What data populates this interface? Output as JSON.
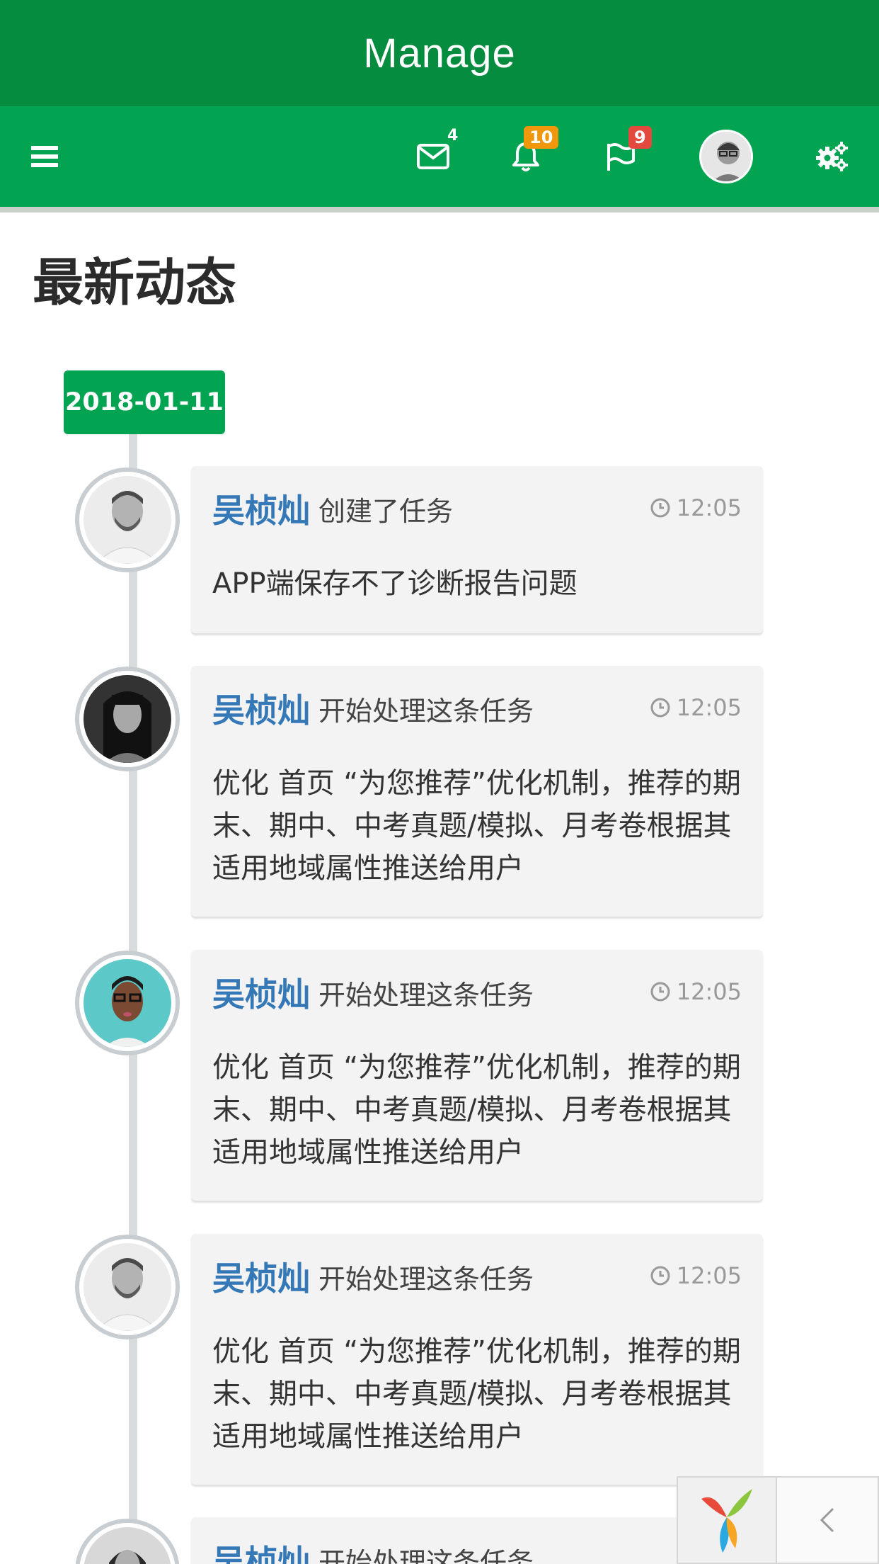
{
  "header": {
    "title": "Manage"
  },
  "toolbar": {
    "menu_icon": "hamburger-icon",
    "mail_badge": "4",
    "bell_badge": "10",
    "flag_badge": "9",
    "settings_icon": "gears-icon",
    "colors": {
      "title_bar": "#058c3f",
      "toolbar": "#02a451",
      "badge_orange": "#f0970b",
      "badge_red": "#e3493d"
    }
  },
  "page": {
    "title": "最新动态"
  },
  "timeline": {
    "date": "2018-01-11",
    "entries": [
      {
        "user": "吴桢灿",
        "action": "创建了任务",
        "time": "12:05",
        "body": "APP端保存不了诊断报告问题"
      },
      {
        "user": "吴桢灿",
        "action": "开始处理这条任务",
        "time": "12:05",
        "body": "优化 首页 “为您推荐”优化机制，推荐的期末、期中、中考真题/模拟、月考卷根据其适用地域属性推送给用户"
      },
      {
        "user": "吴桢灿",
        "action": "开始处理这条任务",
        "time": "12:05",
        "body": "优化 首页 “为您推荐”优化机制，推荐的期末、期中、中考真题/模拟、月考卷根据其适用地域属性推送给用户"
      },
      {
        "user": "吴桢灿",
        "action": "开始处理这条任务",
        "time": "12:05",
        "body": "优化 首页 “为您推荐”优化机制，推荐的期末、期中、中考真题/模拟、月考卷根据其适用地域属性推送给用户"
      },
      {
        "user": "吴桢灿",
        "action": "开始处理这条任务",
        "time": "",
        "body": ""
      }
    ]
  },
  "link_color": "#3478b7"
}
